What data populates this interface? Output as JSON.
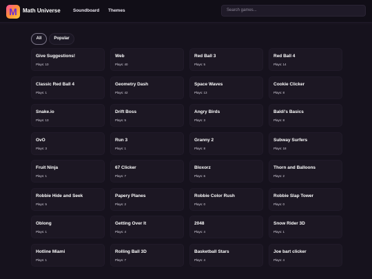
{
  "header": {
    "brand": "Math Universe",
    "logo_glyph": "M",
    "nav": [
      {
        "label": "Soundboard"
      },
      {
        "label": "Themes"
      }
    ],
    "search_placeholder": "Search games..."
  },
  "filters": [
    {
      "label": "All",
      "active": true
    },
    {
      "label": "Popular",
      "active": false
    }
  ],
  "games": [
    {
      "title": "Give Suggestions!",
      "plays": "Plays: 10"
    },
    {
      "title": "Web",
      "plays": "Plays: 40"
    },
    {
      "title": "Red Ball 3",
      "plays": "Plays: 5"
    },
    {
      "title": "Red Ball 4",
      "plays": "Plays: 14"
    },
    {
      "title": "Classic Red Ball 4",
      "plays": "Plays: 1"
    },
    {
      "title": "Geometry Dash",
      "plays": "Plays: 42"
    },
    {
      "title": "Space Waves",
      "plays": "Plays: 13"
    },
    {
      "title": "Cookie Clicker",
      "plays": "Plays: 8"
    },
    {
      "title": "Snake.io",
      "plays": "Plays: 13"
    },
    {
      "title": "Drift Boss",
      "plays": "Plays: 5"
    },
    {
      "title": "Angry Birds",
      "plays": "Plays: 3"
    },
    {
      "title": "Baldi's Basics",
      "plays": "Plays: 8"
    },
    {
      "title": "OvO",
      "plays": "Plays: 3"
    },
    {
      "title": "Run 3",
      "plays": "Plays: 1"
    },
    {
      "title": "Granny 2",
      "plays": "Plays: 8"
    },
    {
      "title": "Subway Surfers",
      "plays": "Plays: 18"
    },
    {
      "title": "Fruit Ninja",
      "plays": "Plays: 1"
    },
    {
      "title": "67 Clicker",
      "plays": "Plays: 7"
    },
    {
      "title": "Bloxorz",
      "plays": "Plays: 6"
    },
    {
      "title": "Thorn and Balloons",
      "plays": "Plays: 2"
    },
    {
      "title": "Robbie Hide and Seek",
      "plays": "Plays: 5"
    },
    {
      "title": "Papery Planes",
      "plays": "Plays: 2"
    },
    {
      "title": "Robbie Color Rush",
      "plays": "Plays: 0"
    },
    {
      "title": "Robbie Slap Tower",
      "plays": "Plays: 0"
    },
    {
      "title": "Oblong",
      "plays": "Plays: 1"
    },
    {
      "title": "Getting Over It",
      "plays": "Plays: 4"
    },
    {
      "title": "2048",
      "plays": "Plays: 4"
    },
    {
      "title": "Snow Rider 3D",
      "plays": "Plays: 1"
    },
    {
      "title": "Hotline Miami",
      "plays": "Plays: 1"
    },
    {
      "title": "Rolling Ball 3D",
      "plays": "Plays: 7"
    },
    {
      "title": "Basketball Stars",
      "plays": "Plays: 4"
    },
    {
      "title": "Joe bart clicker",
      "plays": "Plays: 4"
    }
  ],
  "colors": {
    "background": "#16121d",
    "card": "#1c1723",
    "header": "#110e17"
  }
}
